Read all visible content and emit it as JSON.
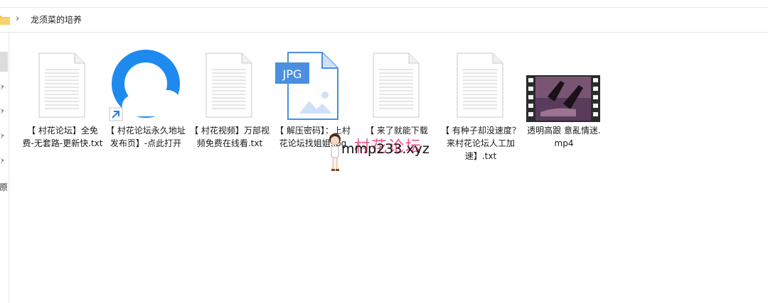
{
  "breadcrumb": {
    "separator": "›",
    "current": "龙须菜的培养"
  },
  "nav": {
    "partial_label": "原"
  },
  "files": [
    {
      "name": "【 村花论坛】全免费-无套路-更新快.txt",
      "icon": "text-file-icon"
    },
    {
      "name": "【 村花论坛永久地址发布页】-点此打开",
      "icon": "browser-shortcut-icon"
    },
    {
      "name": "【 村花视频】万部视频免费在线看.txt",
      "icon": "text-file-icon"
    },
    {
      "name": "【 解压密码】：上村花论坛找姐姐.jpg",
      "icon": "jpg-file-icon",
      "badge": "JPG"
    },
    {
      "name": "【 来了就能下载",
      "icon": "text-file-icon"
    },
    {
      "name": "【 有种子却没速度？来村花论坛人工加速】.txt",
      "icon": "text-file-icon"
    },
    {
      "name": "透明高跟 意亂情迷.mp4",
      "icon": "video-thumbnail-icon"
    }
  ],
  "watermark": {
    "text": "mmp233.xyz",
    "pink_text": "村花论坛"
  }
}
